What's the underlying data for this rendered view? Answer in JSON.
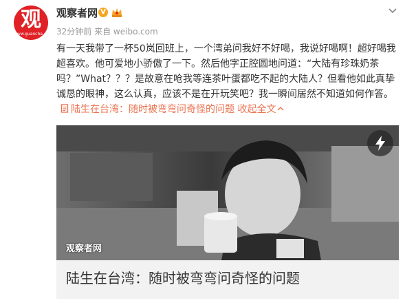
{
  "account": {
    "avatar_main": "观",
    "avatar_sub": "www.guancha.cn",
    "name": "观察者网",
    "verified_mark": "V"
  },
  "meta": {
    "time": "32分钟前",
    "source": "来自 weibo.com"
  },
  "post": {
    "text": "有一天我带了一杯50岚回班上，一个湾弟问我好不好喝，我说好喝啊！超好喝我超喜欢。他可爱地小骄傲了一下。然后他字正腔圆地问道：“大陆有珍珠奶茶吗？”What？？？是故意在呛我等连茶叶蛋都吃不起的大陆人？但看他如此真挚诚恳的眼神，这么认真，应该不是在开玩笑吧？我一瞬间居然不知道如何作答。",
    "link_text": "陆生在台湾：随时被弯弯问奇怪的问题",
    "link_icon": "document-icon",
    "collapse_label": "收起全文",
    "collapse_icon": "chevron-up-icon"
  },
  "card": {
    "watermark": "观察者网",
    "title": "陆生在台湾：随时被弯弯问奇怪的问题",
    "badge_icon": "lightning-icon"
  },
  "colors": {
    "accent": "#eb7350",
    "brand_red": "#e02125",
    "verified": "#f6a623"
  }
}
